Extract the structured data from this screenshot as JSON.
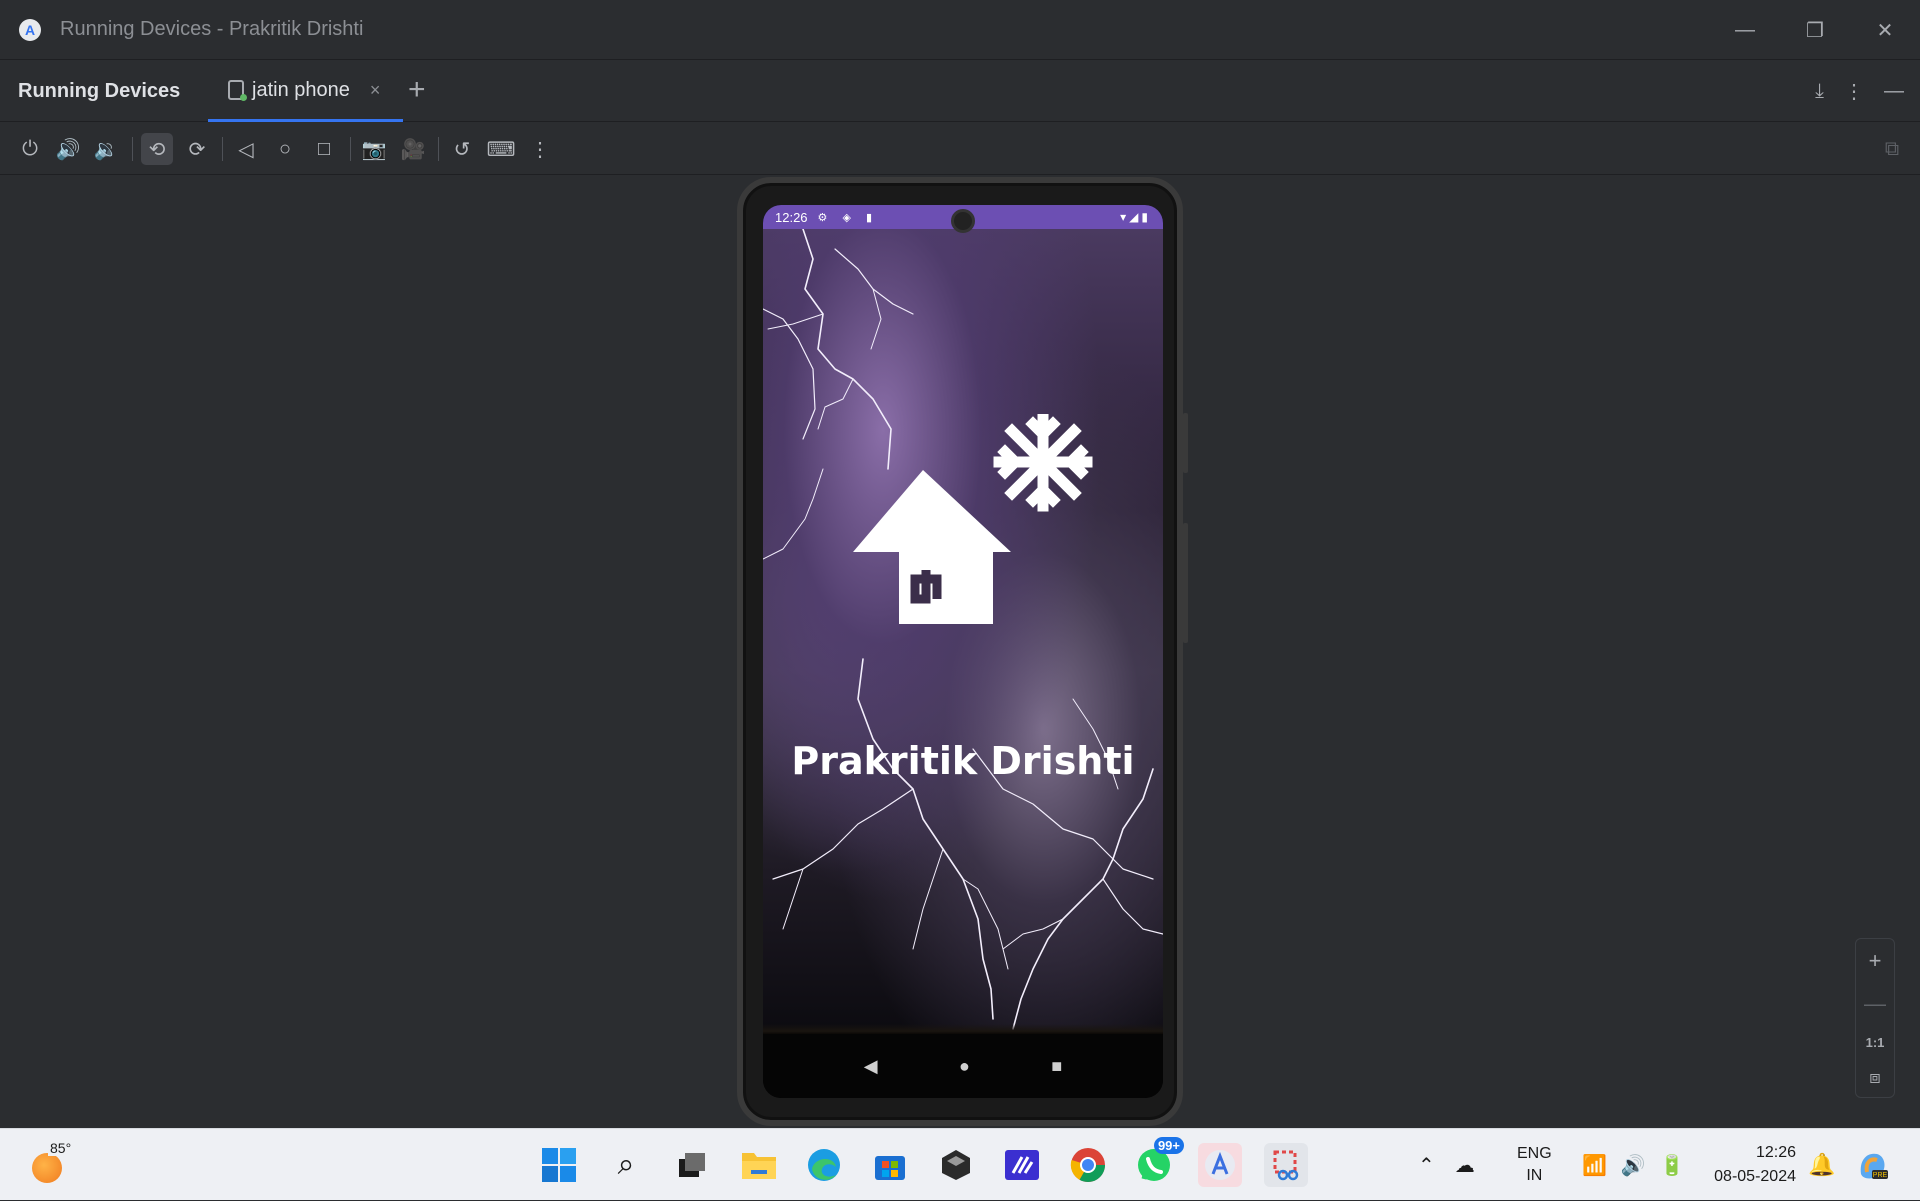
{
  "window": {
    "title": "Running Devices - Prakritik Drishti",
    "app_logo": "android-studio-logo"
  },
  "panel": {
    "title": "Running Devices",
    "tab_label": "jatin phone",
    "tab_close": "×",
    "tab_add": "+"
  },
  "toolbar": {
    "icons": [
      "power-icon",
      "volume-up-icon",
      "volume-down-icon",
      "rotate-left-icon",
      "rotate-right-icon",
      "back-icon",
      "home-icon",
      "overview-icon",
      "screenshot-icon",
      "screen-record-icon",
      "reset-icon",
      "keyboard-icon",
      "more-icon"
    ]
  },
  "phone": {
    "status_time": "12:26",
    "status_icons": "⚙ ◈ ▮",
    "status_right": "▾◢▮",
    "app_name": "Prakritik Drishti",
    "nav": {
      "back": "◀",
      "home": "●",
      "recents": "■"
    }
  },
  "zoom": {
    "plus": "+",
    "minus": "—",
    "actual": "1:1"
  },
  "taskbar": {
    "weather_temp": "85°",
    "whatsapp_badge": "99+",
    "lang_line1": "ENG",
    "lang_line2": "IN",
    "clock_time": "12:26",
    "clock_date": "08-05-2024"
  },
  "colors": {
    "accent": "#3574f0",
    "status_bar": "#6c4fb3",
    "background": "#2b2d30"
  }
}
